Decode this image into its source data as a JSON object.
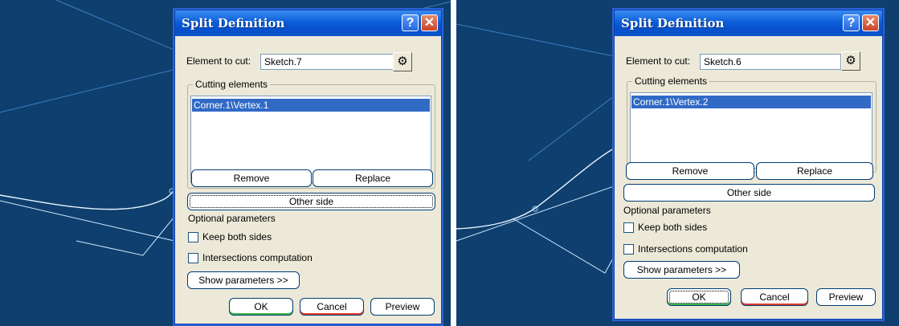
{
  "colors": {
    "viewport_bg": "#0e3f6f",
    "dialog_bg": "#ece9d8",
    "titlebar": "#0750cf",
    "selection": "#316ac5",
    "ok_accent": "#3cb54a",
    "cancel_accent": "#e0392b"
  },
  "icons": {
    "help": "question-mark-icon",
    "close": "close-x-icon",
    "selector": "selection-cursor-icon"
  },
  "dialogs": [
    {
      "title": "Split Definition",
      "help_glyph": "?",
      "close_glyph": "✕",
      "element_to_cut_label": "Element to cut:",
      "element_to_cut_value": "Sketch.7",
      "cutting_elements_title": "Cutting elements",
      "cutting_elements": [
        "Corner.1\\Vertex.1"
      ],
      "remove_label": "Remove",
      "replace_label": "Replace",
      "other_side_label": "Other side",
      "optional_parameters_label": "Optional parameters",
      "keep_both_sides_label": "Keep both sides",
      "keep_both_sides_checked": false,
      "intersections_label": "Intersections computation",
      "intersections_checked": false,
      "show_parameters_label": "Show parameters >>",
      "ok_label": "OK",
      "cancel_label": "Cancel",
      "preview_label": "Preview"
    },
    {
      "title": "Split Definition",
      "help_glyph": "?",
      "close_glyph": "✕",
      "element_to_cut_label": "Element to cut:",
      "element_to_cut_value": "Sketch.6",
      "cutting_elements_title": "Cutting elements",
      "cutting_elements": [
        "Corner.1\\Vertex.2"
      ],
      "remove_label": "Remove",
      "replace_label": "Replace",
      "other_side_label": "Other side",
      "optional_parameters_label": "Optional parameters",
      "keep_both_sides_label": "Keep both sides",
      "keep_both_sides_checked": false,
      "intersections_label": "Intersections computation",
      "intersections_checked": false,
      "show_parameters_label": "Show parameters >>",
      "ok_label": "OK",
      "cancel_label": "Cancel",
      "preview_label": "Preview"
    }
  ]
}
